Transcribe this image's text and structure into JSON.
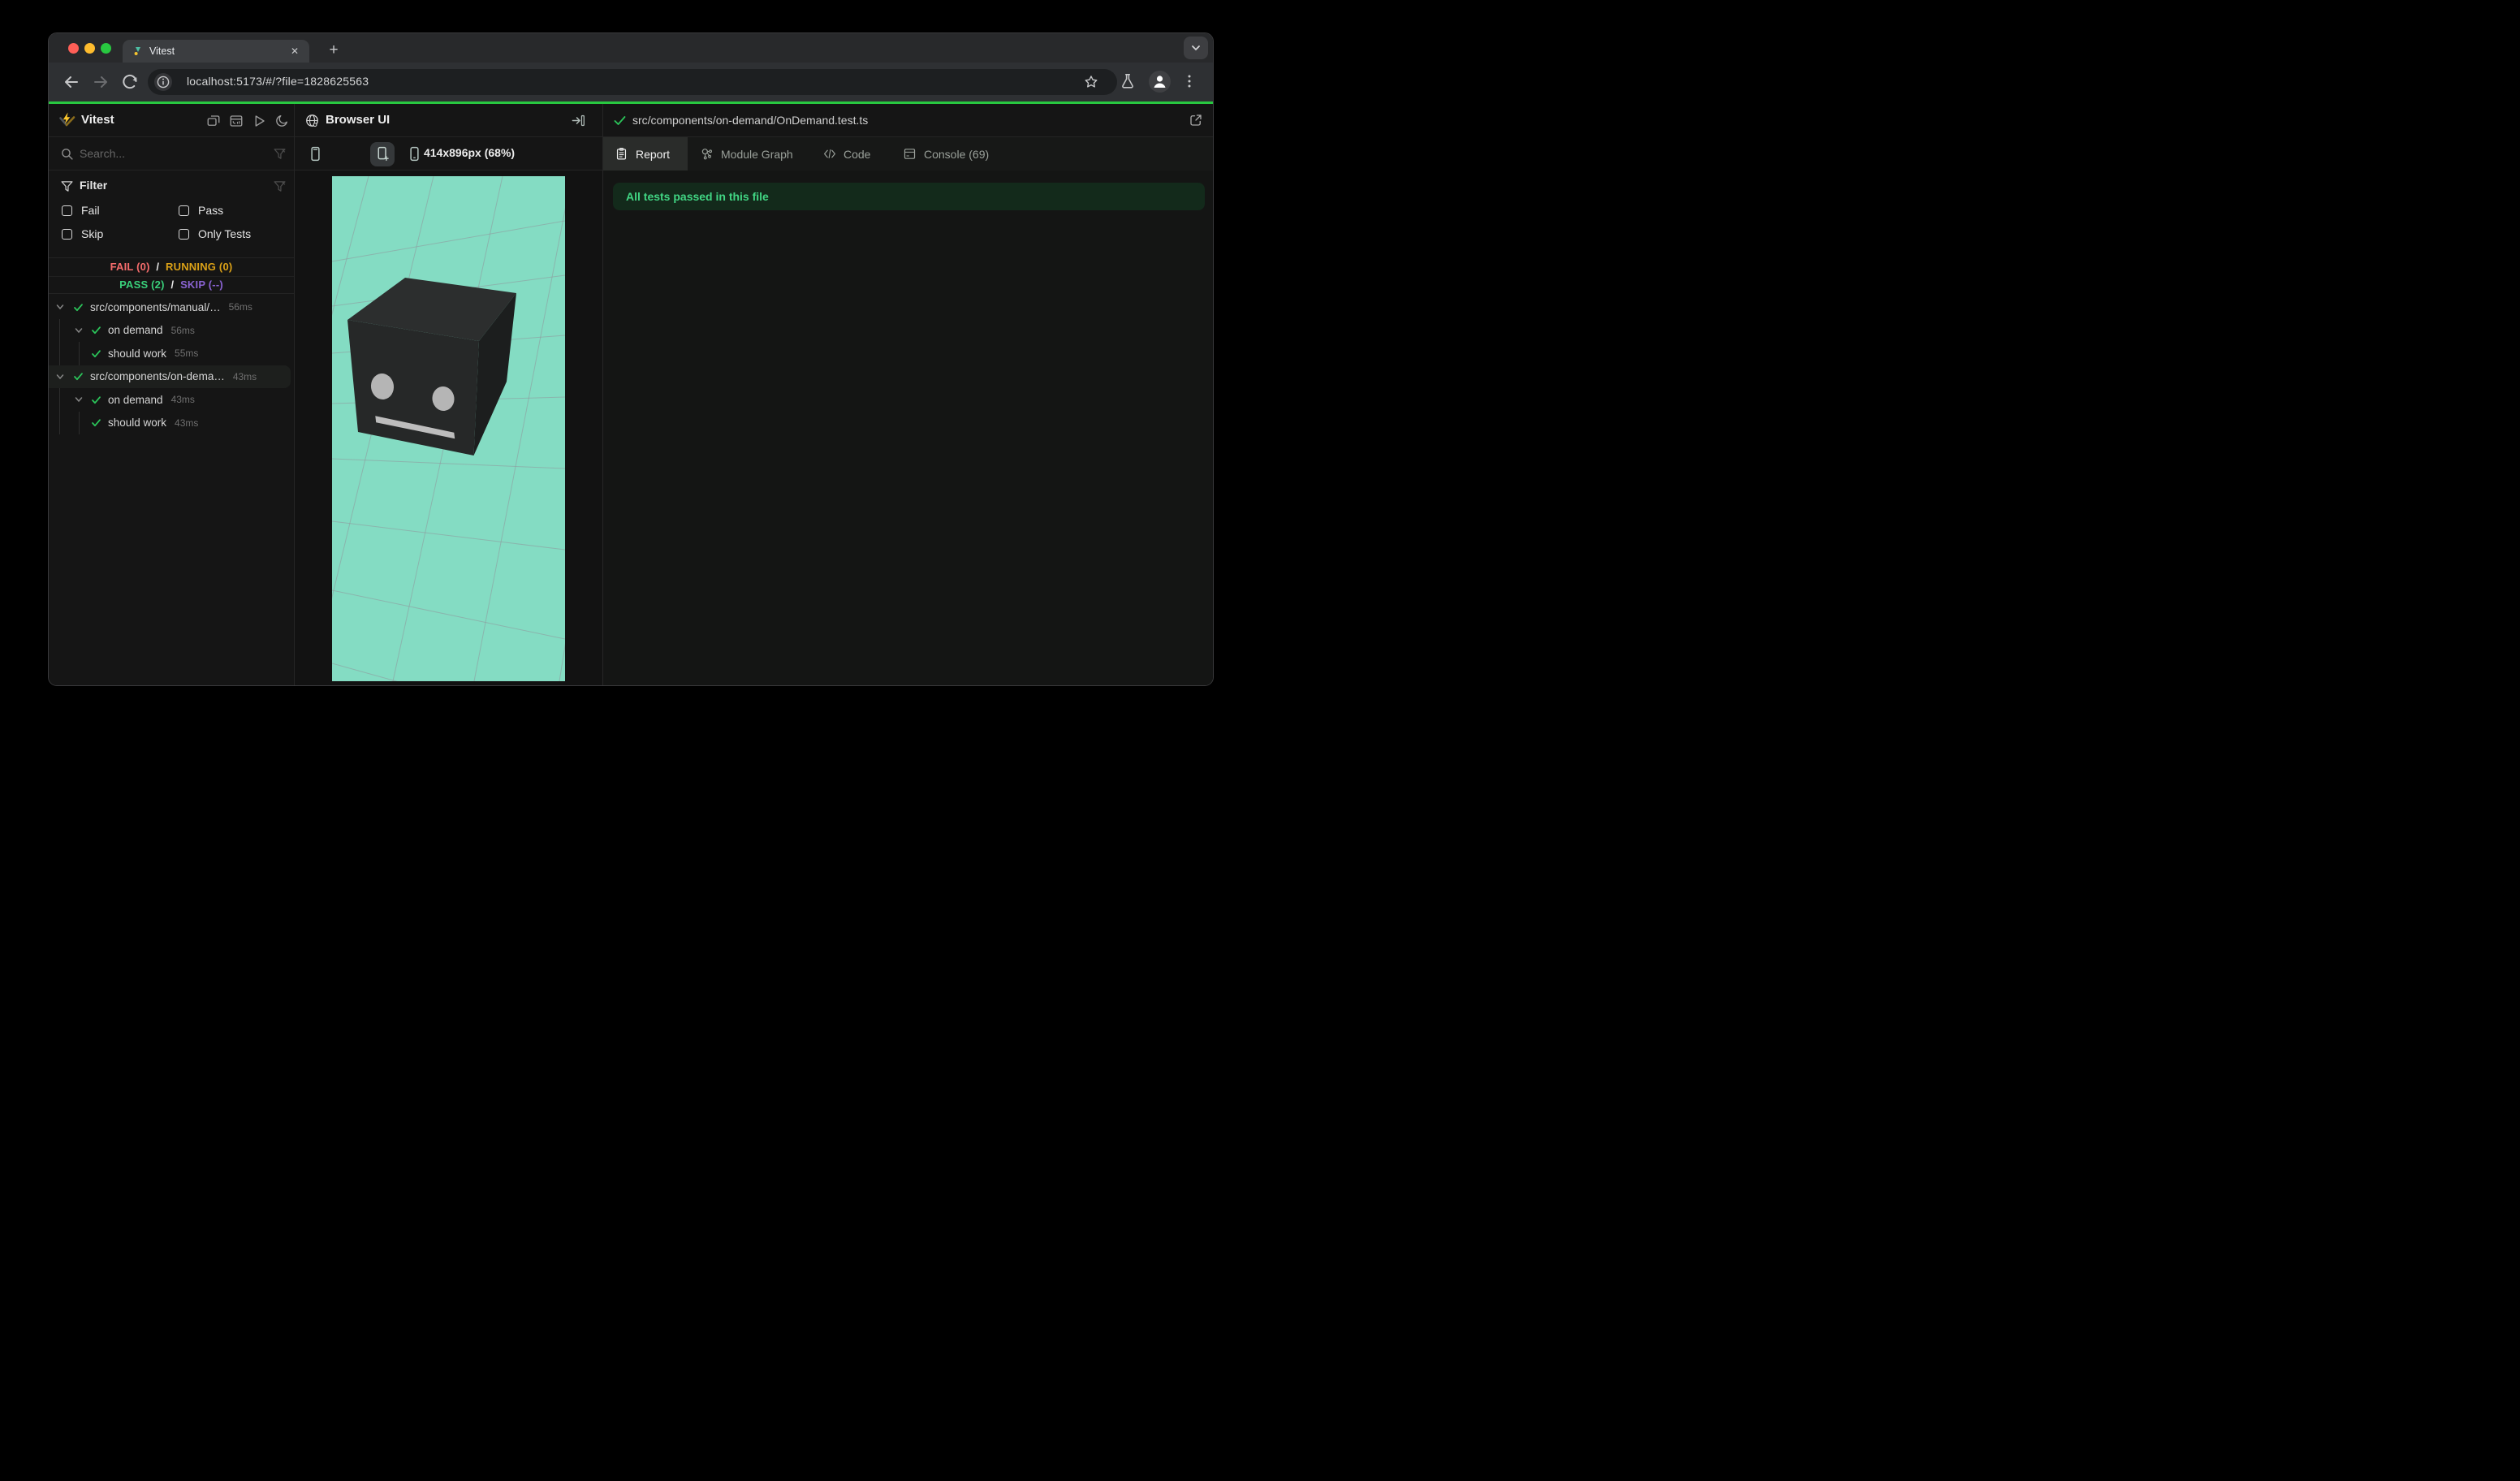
{
  "browser": {
    "tab_title": "Vitest",
    "close_glyph": "✕",
    "new_tab_glyph": "+",
    "url": "localhost:5173/#/?file=1828625563"
  },
  "sidebar": {
    "app_title": "Vitest",
    "search_placeholder": "Search...",
    "filter": {
      "title": "Filter",
      "options": [
        "Fail",
        "Pass",
        "Skip",
        "Only Tests"
      ]
    },
    "status": {
      "fail": "FAIL (0)",
      "running": "RUNNING (0)",
      "pass": "PASS (2)",
      "skip": "SKIP (--)",
      "separator": "/"
    },
    "tree": [
      {
        "label": "src/components/manual/…",
        "time": "56ms",
        "level": 1,
        "selected": false
      },
      {
        "label": "on demand",
        "time": "56ms",
        "level": 2,
        "selected": false
      },
      {
        "label": "should work",
        "time": "55ms",
        "level": 3,
        "selected": false
      },
      {
        "label": "src/components/on-dema…",
        "time": "43ms",
        "level": 1,
        "selected": true
      },
      {
        "label": "on demand",
        "time": "43ms",
        "level": 2,
        "selected": false
      },
      {
        "label": "should work",
        "time": "43ms",
        "level": 3,
        "selected": false
      }
    ]
  },
  "preview": {
    "title": "Browser UI",
    "viewport_label": "414x896px (68%)"
  },
  "results": {
    "file_path": "src/components/on-demand/OnDemand.test.ts",
    "tabs": [
      {
        "label": "Report",
        "active": true
      },
      {
        "label": "Module Graph",
        "active": false
      },
      {
        "label": "Code",
        "active": false
      },
      {
        "label": "Console (69)",
        "active": false
      }
    ],
    "banner_text": "All tests passed in this file"
  },
  "colors": {
    "accent_line_green": "#28c840",
    "mint_viewport_bg": "#84dcc3",
    "grid_line": "#8f969b",
    "fail_red": "#f56c6c",
    "running_yellow": "#dba117",
    "pass_green": "#39cf7a",
    "skip_purple": "#8a63d2",
    "check_green": "#2bc55a",
    "banner_bg": "#132a1b",
    "banner_text": "#41d583",
    "logo_yellow": "#fcc72b",
    "logo_olive": "#8a6c1c",
    "cube_top": "#2c2e2e",
    "cube_front": "#262828",
    "cube_right": "#1c1e1e"
  }
}
